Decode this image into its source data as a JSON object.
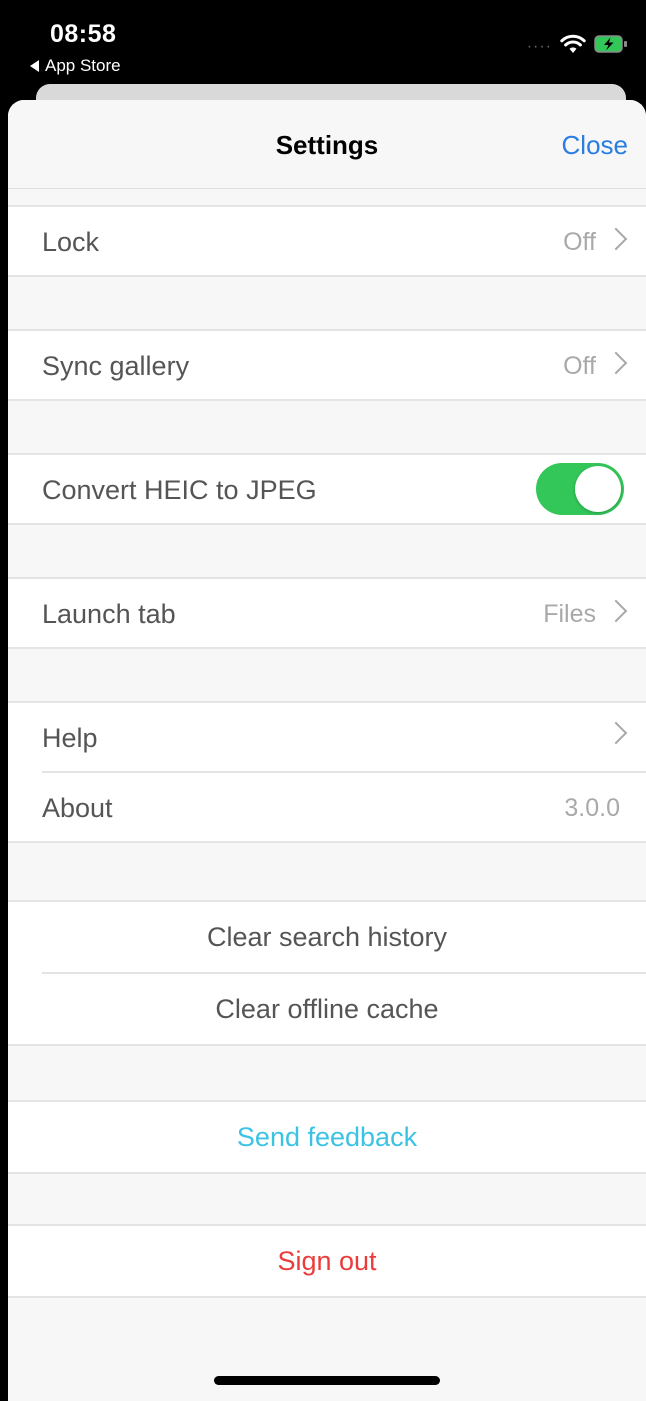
{
  "status": {
    "time": "08:58",
    "back_app": "App Store"
  },
  "nav": {
    "title": "Settings",
    "close": "Close"
  },
  "settings": {
    "lock": {
      "label": "Lock",
      "value": "Off"
    },
    "sync_gallery": {
      "label": "Sync gallery",
      "value": "Off"
    },
    "convert_heic": {
      "label": "Convert HEIC to JPEG",
      "enabled": true
    },
    "launch_tab": {
      "label": "Launch tab",
      "value": "Files"
    },
    "help": {
      "label": "Help"
    },
    "about": {
      "label": "About",
      "value": "3.0.0"
    }
  },
  "actions": {
    "clear_search": "Clear search history",
    "clear_cache": "Clear offline cache",
    "send_feedback": "Send feedback",
    "sign_out": "Sign out"
  },
  "colors": {
    "accent": "#2a7de1",
    "toggle_on": "#33c759",
    "feedback": "#3cc3e4",
    "sign_out": "#ec3b3b"
  }
}
